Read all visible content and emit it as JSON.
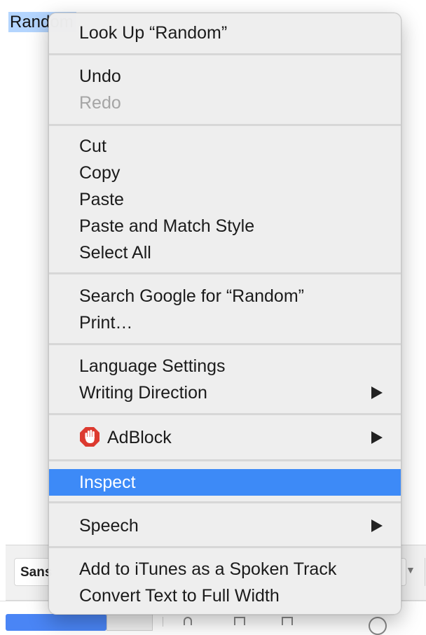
{
  "background": {
    "selected_text": "Random",
    "toolbar_font": "Sans"
  },
  "context_menu": {
    "look_up": "Look Up “Random”",
    "undo": "Undo",
    "redo": "Redo",
    "cut": "Cut",
    "copy": "Copy",
    "paste": "Paste",
    "paste_match": "Paste and Match Style",
    "select_all": "Select All",
    "search_google": "Search Google for “Random”",
    "print": "Print…",
    "language_settings": "Language Settings",
    "writing_direction": "Writing Direction",
    "adblock": "AdBlock",
    "inspect": "Inspect",
    "speech": "Speech",
    "itunes": "Add to iTunes as a Spoken Track",
    "full_width": "Convert Text to Full Width"
  },
  "colors": {
    "highlight": "#3d8af7",
    "selection": "#b4d5fe",
    "adblock_red": "#dc3a2f"
  },
  "icons": {
    "adblock": "adblock-hand-icon",
    "submenu": "triangle-right-icon"
  }
}
